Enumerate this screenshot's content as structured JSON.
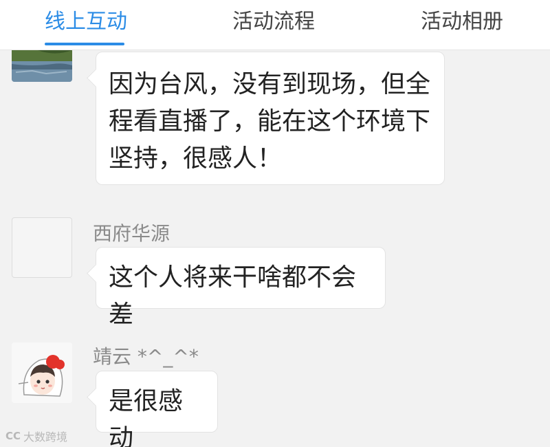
{
  "tabs": [
    {
      "label": "线上互动",
      "active": true
    },
    {
      "label": "活动流程",
      "active": false
    },
    {
      "label": "活动相册",
      "active": false
    }
  ],
  "accent_color": "#2b8ce6",
  "comments": [
    {
      "username": "",
      "avatar": "landscape-photo",
      "text": "因为台风，没有到现场，但全程看直播了，能在这个环境下坚持，很感人！"
    },
    {
      "username": "西府华源",
      "avatar": "blank-avatar",
      "text": "这个人将来干啥都不会差"
    },
    {
      "username": "靖云 *^_^*",
      "avatar": "cartoon-girl-avatar",
      "text": "是很感动"
    }
  ],
  "watermark": {
    "logo": "CC",
    "text": "大数跨境"
  }
}
